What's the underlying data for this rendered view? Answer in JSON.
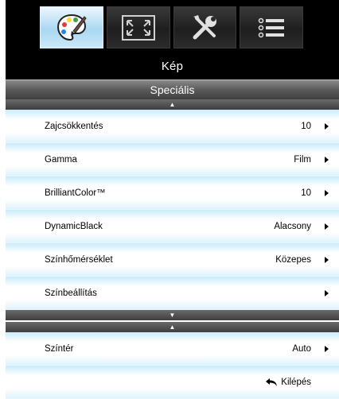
{
  "tabs": [
    {
      "id": "image",
      "icon": "palette-icon",
      "active": true
    },
    {
      "id": "display",
      "icon": "display-frame-icon",
      "active": false
    },
    {
      "id": "setup",
      "icon": "tools-icon",
      "active": false
    },
    {
      "id": "options",
      "icon": "list-icon",
      "active": false
    }
  ],
  "header": {
    "title": "Kép",
    "subtitle": "Speciális"
  },
  "menu": {
    "items": [
      {
        "label": "Zajcsökkentés",
        "value": "10"
      },
      {
        "label": "Gamma",
        "value": "Film"
      },
      {
        "label": "BrilliantColor™",
        "value": "10"
      },
      {
        "label": "DynamicBlack",
        "value": "Alacsony"
      },
      {
        "label": "Színhőmérséklet",
        "value": "Közepes"
      },
      {
        "label": "Színbeállítás",
        "value": ""
      }
    ]
  },
  "page2": {
    "items": [
      {
        "label": "Színtér",
        "value": "Auto"
      }
    ],
    "exit_label": "Kilépés"
  },
  "colors": {
    "accent": "#a9d8f2",
    "header_bg": "#000000",
    "row_edge": "#c7ecfb"
  }
}
